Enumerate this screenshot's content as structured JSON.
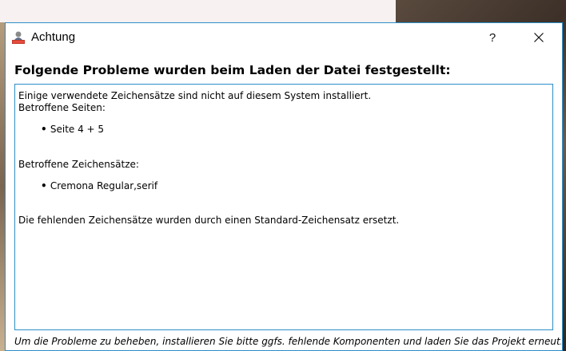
{
  "window": {
    "title": "Achtung",
    "help_label": "?",
    "icons": {
      "app": "app-icon",
      "close": "close-icon"
    }
  },
  "dialog": {
    "heading": "Folgende Probleme wurden beim Laden der Datei festgestellt:",
    "content": {
      "intro": "Einige verwendete Zeichensätze sind nicht auf diesem System installiert.",
      "pages_label": "Betroffene Seiten:",
      "pages": [
        "Seite 4 + 5"
      ],
      "fonts_label": "Betroffene Zeichensätze:",
      "fonts": [
        "Cremona Regular,serif"
      ],
      "replacement_note": "Die fehlenden Zeichensätze wurden durch einen Standard-Zeichensatz ersetzt."
    },
    "footer": "Um die Probleme zu beheben, installieren Sie bitte ggfs. fehlende Komponenten und laden Sie das Projekt erneut."
  },
  "colors": {
    "accent_border": "#2b8ec7"
  }
}
